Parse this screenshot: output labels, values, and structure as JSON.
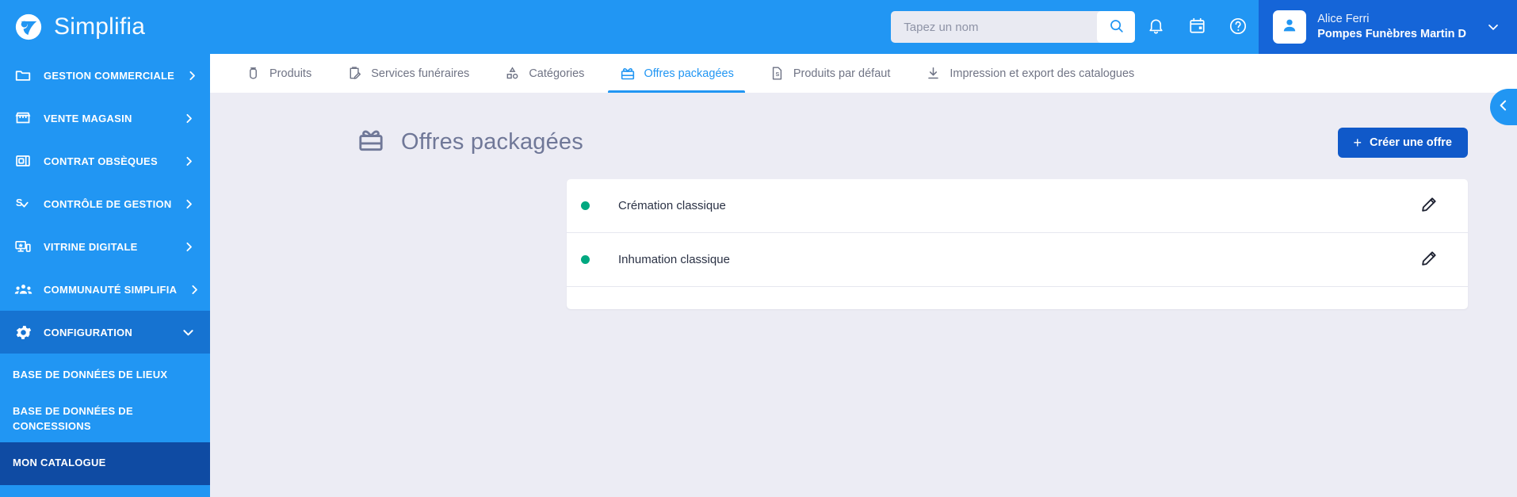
{
  "brand": {
    "name": "Simplifia",
    "logo_icon": "simplifia-logo-icon"
  },
  "header": {
    "search": {
      "placeholder": "Tapez un nom",
      "value": "",
      "icon": "search-icon"
    },
    "notifications_icon": "bell-icon",
    "calendar_icon": "calendar-icon",
    "help_icon": "help-circle-icon",
    "user": {
      "avatar_icon": "user-avatar-icon",
      "name": "Alice Ferri",
      "company": "Pompes Funèbres Martin D",
      "caret_icon": "chevron-down-icon"
    }
  },
  "sidebar": {
    "items": [
      {
        "label": "GESTION COMMERCIALE",
        "icon": "folder-icon",
        "caret": "chevron-right-icon",
        "expanded": false
      },
      {
        "label": "VENTE MAGASIN",
        "icon": "store-icon",
        "caret": "chevron-right-icon",
        "expanded": false
      },
      {
        "label": "CONTRAT OBSÈQUES",
        "icon": "contract-card-icon",
        "caret": "chevron-right-icon",
        "expanded": false
      },
      {
        "label": "CONTRÔLE DE GESTION",
        "icon": "finance-check-icon",
        "caret": "chevron-right-icon",
        "expanded": false
      },
      {
        "label": "VITRINE DIGITALE",
        "icon": "digital-showcase-icon",
        "caret": "chevron-right-icon",
        "expanded": false
      },
      {
        "label": "COMMUNAUTÉ SIMPLIFIA",
        "icon": "people-group-icon",
        "caret": "chevron-right-icon",
        "expanded": false
      },
      {
        "label": "CONFIGURATION",
        "icon": "gear-icon",
        "caret": "chevron-down-icon",
        "expanded": true
      }
    ],
    "subitems": [
      {
        "label": "BASE DE DONNÉES DE LIEUX",
        "active": false
      },
      {
        "label": "BASE DE DONNÉES DE CONCESSIONS",
        "active": false
      },
      {
        "label": "MON CATALOGUE",
        "active": true
      }
    ]
  },
  "tabs": [
    {
      "label": "Produits",
      "icon": "urn-icon",
      "active": false
    },
    {
      "label": "Services funéraires",
      "icon": "clipboard-edit-icon",
      "active": false
    },
    {
      "label": "Catégories",
      "icon": "shapes-icon",
      "active": false
    },
    {
      "label": "Offres packagées",
      "icon": "gift-box-icon",
      "active": true
    },
    {
      "label": "Produits par défaut",
      "icon": "price-document-icon",
      "active": false
    },
    {
      "label": "Impression et export des catalogues",
      "icon": "download-icon",
      "active": false
    }
  ],
  "main": {
    "title": "Offres packagées",
    "title_icon": "gift-box-icon",
    "create_button": {
      "label": "Créer une offre",
      "plus": "+"
    },
    "offers": [
      {
        "status": "active",
        "name": "Crémation classique",
        "edit_icon": "pencil-icon"
      },
      {
        "status": "active",
        "name": "Inhumation classique",
        "edit_icon": "pencil-icon"
      }
    ]
  },
  "panel_handle": {
    "icon": "chevron-left-icon"
  },
  "colors": {
    "brand_blue": "#2196f3",
    "header_user_blue": "#1565d8",
    "active_subnav_blue": "#0f4ba3",
    "expanded_nav_blue": "#1673d1",
    "primary_button_blue": "#1059c9",
    "page_background": "#ececf4",
    "status_green": "#00a880",
    "title_grey": "#707898"
  }
}
